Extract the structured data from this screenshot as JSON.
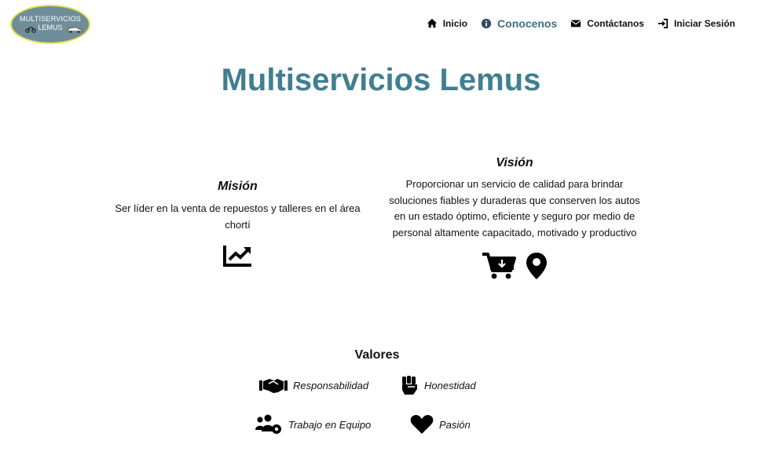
{
  "logo": {
    "line1": "MULTISERVICIOS",
    "line2": "LEMUS"
  },
  "nav": {
    "inicio": "Inicio",
    "conocenos": "Conocenos",
    "contactanos": "Contáctanos",
    "login": "Iniciar Sesión"
  },
  "page_title": "Multiservicios Lemus",
  "mision": {
    "title": "Misión",
    "text": "Ser líder en la venta de repuestos y talleres en el área chortí"
  },
  "vision": {
    "title": "Visión",
    "text": "Proporcionar un servicio de calidad para brindar soluciones fiables y duraderas que conserven los autos en un estado óptimo, eficiente y seguro por medio de personal altamente capacitado, motivado y productivo"
  },
  "valores": {
    "title": "Valores",
    "items": [
      {
        "label": "Responsabilidad",
        "icon": "handshake-icon"
      },
      {
        "label": "Honestidad",
        "icon": "fist-icon"
      },
      {
        "label": "Trabajo en Equipo",
        "icon": "users-cog-icon"
      },
      {
        "label": "Pasión",
        "icon": "heart-icon"
      }
    ]
  },
  "colors": {
    "title": "#3f7f90",
    "active_nav": "#3a6f85",
    "logo_bg": "#6f8e99",
    "logo_border": "#e2e44a"
  }
}
